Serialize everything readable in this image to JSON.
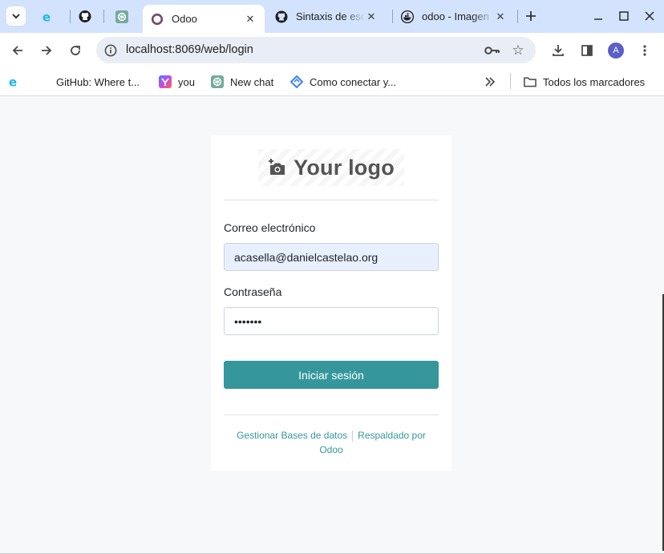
{
  "browser": {
    "tabs": [
      {
        "title": "",
        "icon": "edge-e-icon"
      },
      {
        "title": "",
        "icon": "github-icon"
      },
      {
        "title": "",
        "icon": "chatgpt-icon"
      },
      {
        "title": "Odoo",
        "icon": "odoo-icon",
        "active": true
      },
      {
        "title": "Sintaxis de esc",
        "icon": "github-icon"
      },
      {
        "title": "odoo - Imagen",
        "icon": "docker-icon"
      }
    ],
    "url": "localhost:8069/web/login",
    "profile_initial": "A"
  },
  "bookmarks": {
    "items": [
      {
        "label": "GitHub: Where t...",
        "icon": "edge-e-icon"
      },
      {
        "label": "you",
        "icon": "gradient-app-icon"
      },
      {
        "label": "New chat",
        "icon": "chatgpt-icon"
      },
      {
        "label": "Como conectar y...",
        "icon": "diamond-icon"
      }
    ],
    "all_bookmarks": "Todos los marcadores"
  },
  "login": {
    "logo_text": "Your logo",
    "email_label": "Correo electrónico",
    "email_value": "acasella@danielcastelao.org",
    "password_label": "Contraseña",
    "password_value": "•••••••",
    "submit_label": "Iniciar sesión",
    "manage_db_link": "Gestionar Bases de datos",
    "powered_by_link": "Respaldado por Odoo"
  },
  "colors": {
    "accent": "#35979c",
    "tab_strip": "#d3e3fd",
    "page_bg": "#f7f8fa",
    "autofill_bg": "#e8f0fe"
  }
}
